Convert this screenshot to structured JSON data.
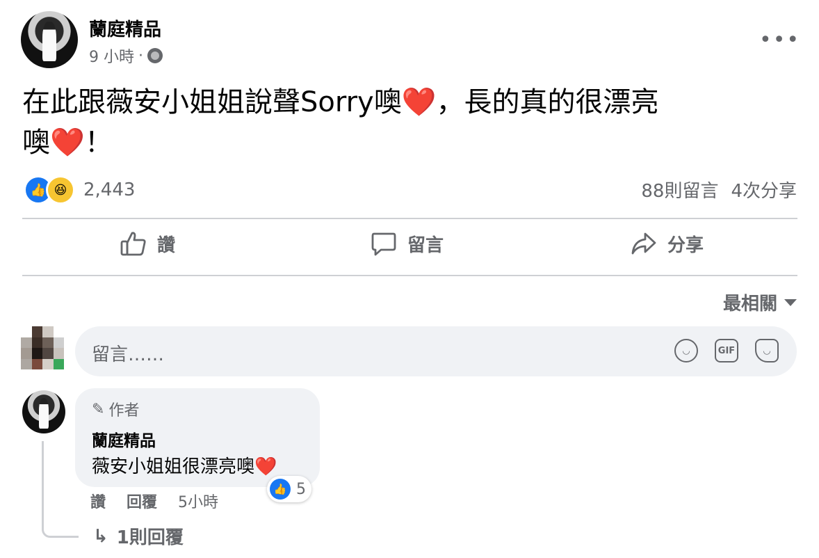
{
  "post": {
    "author": "蘭庭精品",
    "time": "9 小時",
    "separator": "·",
    "more_icon": "•••",
    "text_line1": "在此跟薇安小姐姐說聲Sorry噢",
    "text_line1_tail": "，長的真的很漂亮",
    "text_line2": "噢",
    "text_line2_tail": "！",
    "heart_emoji": "❤️",
    "reactions": {
      "like_icon": "👍",
      "haha_icon": "😆",
      "count": "2,443"
    },
    "comments_count": "88則留言",
    "shares_count": "4次分享"
  },
  "actions": {
    "like": "讚",
    "comment": "留言",
    "share": "分享"
  },
  "sort": {
    "label": "最相關"
  },
  "composer": {
    "placeholder": "留言……",
    "icons": [
      "emoji-icon",
      "gif-icon",
      "sticker-icon"
    ],
    "gif_label": "GIF"
  },
  "comment": {
    "badge": "作者",
    "author": "蘭庭精品",
    "text": "薇安小姐姐很漂亮噢",
    "heart_emoji": "❤️",
    "like_count": "5",
    "like_action": "讚",
    "reply_action": "回覆",
    "time": "5小時",
    "replies_link": "1則回覆"
  },
  "colors": {
    "accent": "#1877f2",
    "muted": "#65676b",
    "heart": "#e8202e",
    "bubble": "#f0f2f5"
  }
}
